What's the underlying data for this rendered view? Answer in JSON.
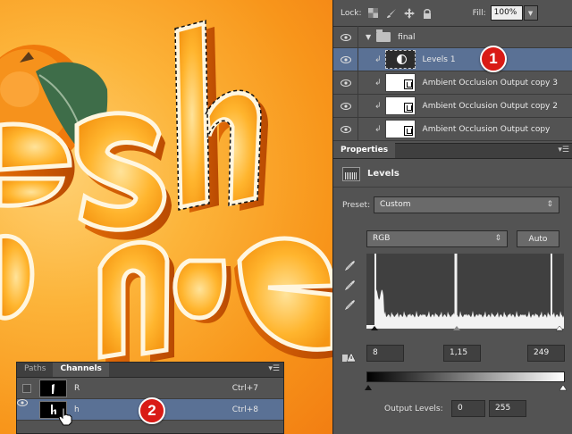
{
  "layers_panel": {
    "lock_label": "Lock:",
    "fill_label": "Fill:",
    "fill_value": "100%",
    "group_name": "final",
    "layers": [
      {
        "name": "Levels 1",
        "type": "adjustment",
        "selected": true
      },
      {
        "name": "Ambient Occlusion Output copy 3",
        "type": "pixel"
      },
      {
        "name": "Ambient Occlusion Output copy 2",
        "type": "pixel"
      },
      {
        "name": "Ambient Occlusion Output copy",
        "type": "pixel"
      }
    ]
  },
  "badges": {
    "one": "1",
    "two": "2"
  },
  "properties": {
    "tab": "Properties",
    "title": "Levels",
    "preset_label": "Preset:",
    "preset_value": "Custom",
    "channel_value": "RGB",
    "auto_button": "Auto",
    "input_black": "8",
    "input_gamma": "1,15",
    "input_white": "249",
    "output_label": "Output Levels:",
    "output_black": "0",
    "output_white": "255"
  },
  "channels_panel": {
    "tabs": [
      "Paths",
      "Channels"
    ],
    "active_tab": "Channels",
    "channels": [
      {
        "name": "R",
        "shortcut": "Ctrl+7",
        "visible": false
      },
      {
        "name": "h",
        "shortcut": "Ctrl+8",
        "visible": true,
        "selected": true
      }
    ]
  },
  "colors": {
    "selection_blue": "#5a7195",
    "badge_red": "#d91b16",
    "panel_gray": "#535353",
    "canvas_orange": "#f8961b"
  },
  "icons": [
    "eye-icon",
    "folder-icon",
    "lock-transparent-icon",
    "lock-brush-icon",
    "lock-move-icon",
    "lock-all-icon",
    "eyedropper-icon",
    "clip-arrow-icon",
    "panel-menu-icon",
    "hand-cursor-icon",
    "histogram-icon"
  ]
}
